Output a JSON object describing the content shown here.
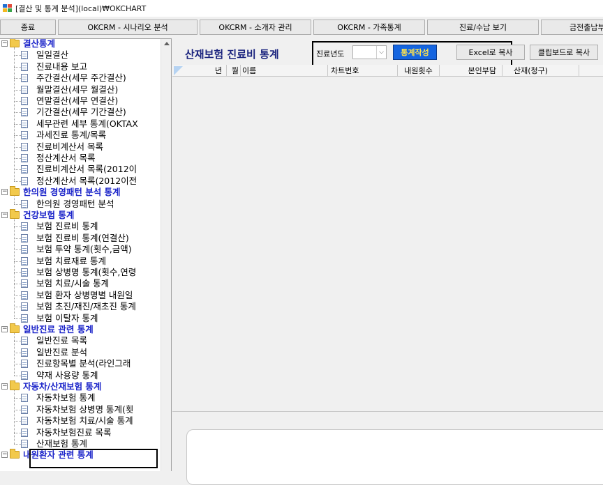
{
  "window": {
    "title": "[결산 및 통계 분석](local)₩OKCHART"
  },
  "toolbar": {
    "buttons": [
      "종료",
      "OKCRM - 시나리오 분석",
      "OKCRM - 소개자 관리",
      "OKCRM - 가족통계",
      "진료/수납 보기",
      "금전출납부"
    ]
  },
  "tree": {
    "groups": [
      {
        "label": "결산통계",
        "items": [
          "일일결산",
          "진료내용 보고",
          "주간결산(세무 주간결산)",
          "월말결산(세무 월결산)",
          "연말결산(세무 연결산)",
          "기간결산(세무 기간결산)",
          "세무관련 세부 통계(OKTAX",
          "과세진료 통계/목록",
          "진료비계산서 목록",
          "정산계산서 목록",
          "진료비계산서 목록(2012이",
          "정산계산서 목록(2012이전"
        ]
      },
      {
        "label": "한의원 경영패턴 분석 통계",
        "items": [
          "한의원 경영패턴 분석"
        ]
      },
      {
        "label": "건강보험 통계",
        "items": [
          "보험 진료비 통계",
          "보험 진료비 통계(연결산)",
          "보험 투약 통계(횟수,금액)",
          "보험 치료재료 통계",
          "보험 상병명 통계(횟수,연령",
          "보험 치료/시술 통계",
          "보험 환자 상병명별 내원일",
          "보험 초진/재진/재초진 통계",
          "보험 이탈자 통계"
        ]
      },
      {
        "label": "일반진료 관련 통계",
        "items": [
          "일반진료 목록",
          "일반진료 분석",
          "진료항목별 분석(라인그래",
          "약재 사용량 통계"
        ]
      },
      {
        "label": "자동차/산재보험 통계",
        "items": [
          "자동차보험 통계",
          "자동차보험 상병명 통계(횟",
          "자동차보험 치료/시술 통계",
          "자동차보험진료 목록",
          "산재보험 통계"
        ]
      },
      {
        "label": "내원환자 관련 통계",
        "items": []
      }
    ],
    "selected_item": "산재보험 통계"
  },
  "panel": {
    "title": "산재보험 진료비 통계",
    "year_label": "진료년도",
    "year_value": "",
    "make_button": "통계작성",
    "excel_button": "Excel로 복사",
    "clipboard_button": "클립보드로 복사"
  },
  "grid": {
    "columns": [
      "년",
      "월",
      "이름",
      "차트번호",
      "내원횟수",
      "본인부담",
      "산재(청구)"
    ]
  },
  "colors": {
    "group_text": "#1a23c9",
    "panel_title": "#1a237e",
    "make_button_bg": "#1565e0",
    "make_button_text": "#ffe44d"
  }
}
